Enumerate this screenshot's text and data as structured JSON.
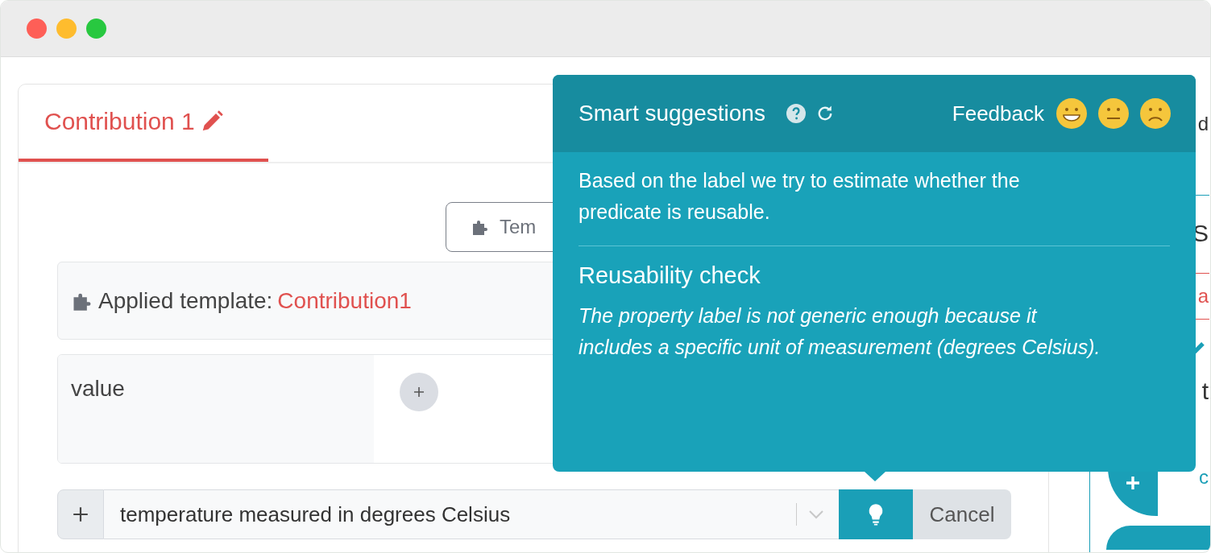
{
  "tabs": [
    {
      "label": "Contribution 1",
      "selected": true
    }
  ],
  "template_button": {
    "label": "Tem"
  },
  "applied_template": {
    "label": "Applied template:",
    "name": "Contribution1"
  },
  "properties": [
    {
      "label": "value"
    }
  ],
  "new_property": {
    "value": "temperature measured in degrees Celsius",
    "cancel": "Cancel"
  },
  "smart_suggestions": {
    "title": "Smart suggestions",
    "feedback_label": "Feedback",
    "feedback": [
      {
        "kind": "grin"
      },
      {
        "kind": "neutral"
      },
      {
        "kind": "frown"
      }
    ],
    "intro": "Based on the label we try to estimate whether the predicate is reusable.",
    "section_title": "Reusability check",
    "explanation": "The property label is not generic enough because it includes a specific unit of measurement (degrees Celsius)."
  },
  "side_panel": [
    {
      "text": "d",
      "kind": "plain"
    },
    {
      "text": "S",
      "kind": "heading"
    },
    {
      "text": "a",
      "kind": "link"
    },
    {
      "text": "t",
      "kind": "plain"
    },
    {
      "text": "c",
      "kind": "button"
    }
  ]
}
